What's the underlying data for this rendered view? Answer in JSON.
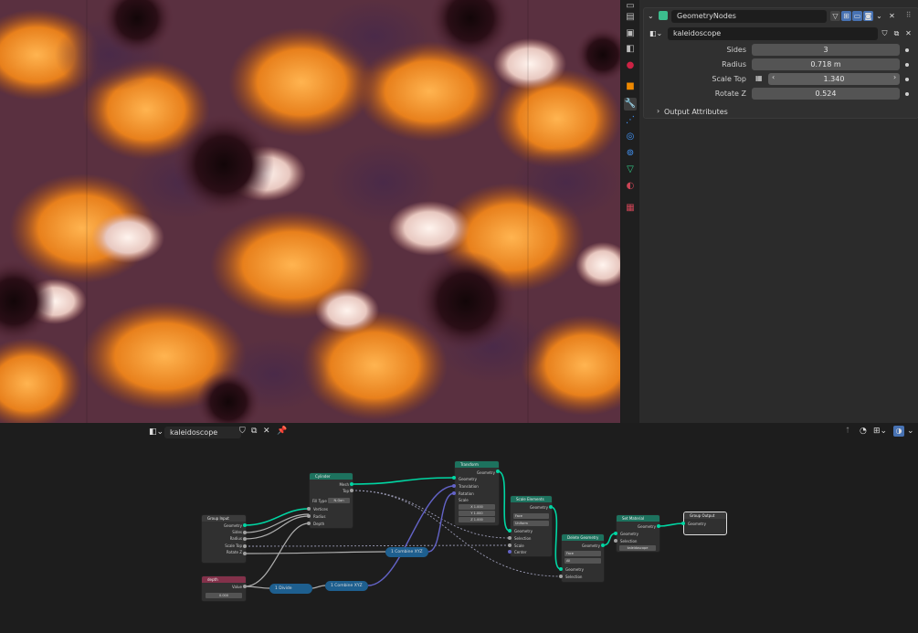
{
  "properties": {
    "modifier_name": "GeometryNodes",
    "node_group": "kaleidoscope",
    "params": [
      {
        "label": "Sides",
        "value": "3"
      },
      {
        "label": "Radius",
        "value": "0.718 m"
      },
      {
        "label": "Scale Top",
        "value": "1.340"
      },
      {
        "label": "Rotate Z",
        "value": "0.524"
      }
    ],
    "output_attributes": "Output Attributes"
  },
  "node_editor": {
    "node_group": "kaleidoscope"
  },
  "nodes": {
    "group_input": {
      "title": "Group Input",
      "outputs": [
        "Geometry",
        "Sides",
        "Radius",
        "Scale Top",
        "Rotate Z"
      ]
    },
    "depth": {
      "title": "depth",
      "out": "Value",
      "value": "0.000"
    },
    "cylinder": {
      "title": "Cylinder",
      "outputs": [
        "Mesh",
        "Top"
      ],
      "fill_label": "Fill Type",
      "fill_value": "N-Gon",
      "inputs": [
        "Vertices",
        "Radius",
        "Depth"
      ]
    },
    "transform": {
      "title": "Transform",
      "out": "Geometry",
      "inputs": [
        "Geometry",
        "Translation",
        "Rotation",
        "Scale"
      ],
      "scale_label": "Scale",
      "x": "1.000",
      "y": "1.000",
      "z": "1.000",
      "xl": "X",
      "yl": "Y",
      "zl": "Z"
    },
    "scale_elements": {
      "title": "Scale Elements",
      "out": "Geometry",
      "domain": "Face",
      "mode": "Uniform",
      "inputs": [
        "Geometry",
        "Selection",
        "Scale",
        "Center"
      ]
    },
    "delete_geometry": {
      "title": "Delete Geometry",
      "out": "Geometry",
      "domain": "Face",
      "mode": "All",
      "inputs": [
        "Geometry",
        "Selection"
      ]
    },
    "set_material": {
      "title": "Set Material",
      "out": "Geometry",
      "inputs": [
        "Geometry",
        "Selection"
      ],
      "material": "kaleidoscope"
    },
    "group_output": {
      "title": "Group Output",
      "inputs": [
        "Geometry"
      ]
    },
    "divide": {
      "label": "1 Divide"
    },
    "combine1": {
      "label": "1 Combine XYZ"
    },
    "combine2": {
      "label": "1 Combine XYZ"
    }
  },
  "colors": {
    "geometry_socket": "#00d6a3",
    "float_socket": "#a1a1a1",
    "vector_socket": "#6363c7",
    "node_geometry_header": "#1d725e",
    "node_input_header": "#3b3b3b",
    "node_output_header": "#3b3b3b",
    "node_value_header": "#83314a",
    "node_vector_header": "#1e5f8f"
  }
}
